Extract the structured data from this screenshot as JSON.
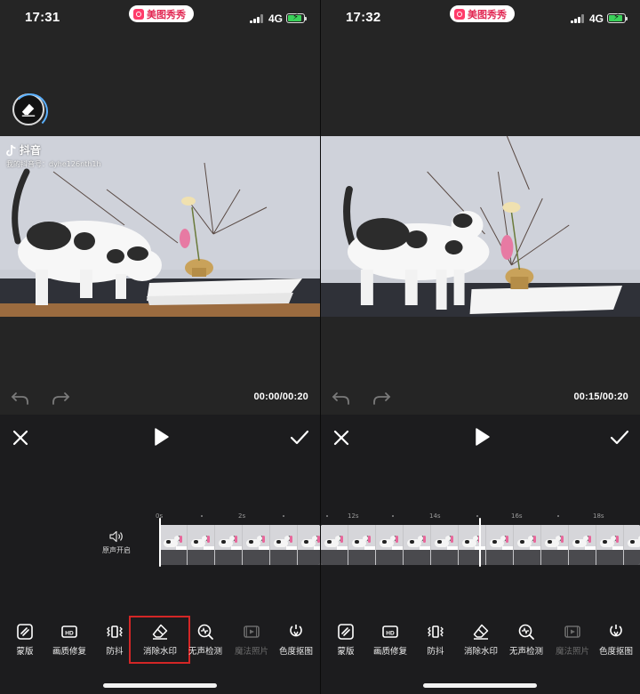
{
  "screens": [
    {
      "status": {
        "time": "17:31",
        "network": "4G",
        "app_badge": "美图秀秀"
      },
      "watermark": {
        "brand": "抖音",
        "account": "我的抖音号：dyhe126nth1h"
      },
      "timecode": "00:00/00:20",
      "ruler": {
        "labels": [
          "0s",
          "2s"
        ]
      },
      "audio_track_label": "原声开启",
      "tools": [
        {
          "label": "蒙版",
          "icon": "mask-icon",
          "enabled": true
        },
        {
          "label": "画质修复",
          "icon": "hd-icon",
          "enabled": true
        },
        {
          "label": "防抖",
          "icon": "stabilize-icon",
          "enabled": true
        },
        {
          "label": "消除水印",
          "icon": "eraser-icon",
          "enabled": true,
          "highlighted": true
        },
        {
          "label": "无声检测",
          "icon": "silence-detect-icon",
          "enabled": true
        },
        {
          "label": "魔法照片",
          "icon": "magic-photo-icon",
          "enabled": false
        },
        {
          "label": "色度抠图",
          "icon": "chroma-key-icon",
          "enabled": true
        }
      ]
    },
    {
      "status": {
        "time": "17:32",
        "network": "4G",
        "app_badge": "美图秀秀"
      },
      "timecode": "00:15/00:20",
      "ruler": {
        "labels": [
          "12s",
          "14s",
          "16s",
          "18s"
        ]
      },
      "tools": [
        {
          "label": "蒙版",
          "icon": "mask-icon",
          "enabled": true
        },
        {
          "label": "画质修复",
          "icon": "hd-icon",
          "enabled": true
        },
        {
          "label": "防抖",
          "icon": "stabilize-icon",
          "enabled": true
        },
        {
          "label": "消除水印",
          "icon": "eraser-icon",
          "enabled": true
        },
        {
          "label": "无声检测",
          "icon": "silence-detect-icon",
          "enabled": true
        },
        {
          "label": "魔法照片",
          "icon": "magic-photo-icon",
          "enabled": false
        },
        {
          "label": "色度抠图",
          "icon": "chroma-key-icon",
          "enabled": true
        }
      ]
    }
  ],
  "colors": {
    "highlight": "#d32626",
    "battery": "#3bd15a",
    "brand": "#ff3b6a"
  }
}
